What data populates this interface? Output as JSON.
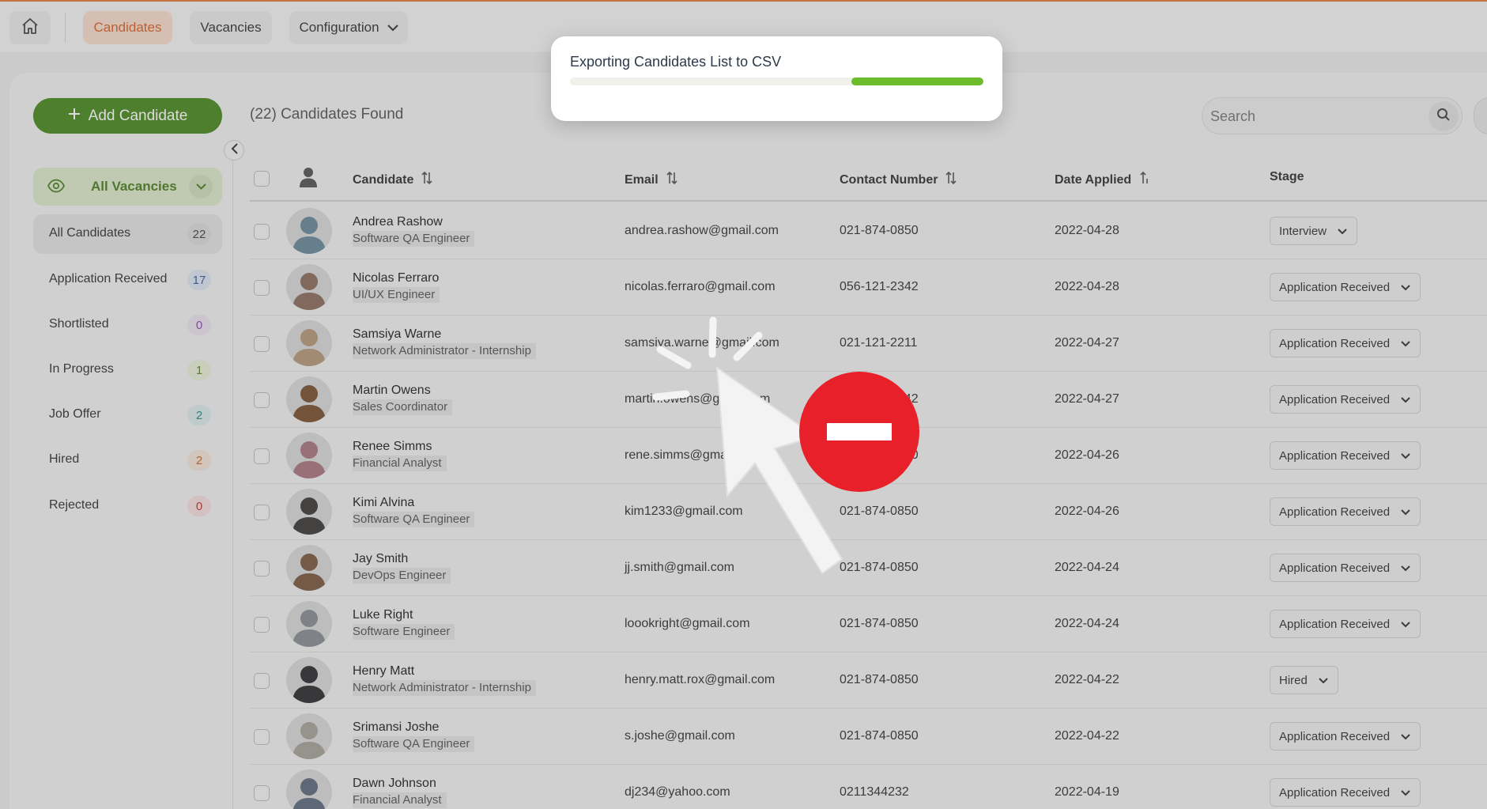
{
  "nav": {
    "home_icon": "home-icon",
    "tabs": [
      {
        "label": "Candidates",
        "active": true
      },
      {
        "label": "Vacancies",
        "active": false
      },
      {
        "label": "Configuration",
        "active": false,
        "has_dropdown": true
      }
    ]
  },
  "toolbar": {
    "add_label": "Add Candidate",
    "found_text": "(22) Candidates Found",
    "search_placeholder": "Search"
  },
  "vacancy_filter": {
    "label": "All Vacancies"
  },
  "stages": [
    {
      "label": "All Candidates",
      "count": "22",
      "active": true,
      "count_bg": "#dcdcdc",
      "count_color": "#444444"
    },
    {
      "label": "Application Received",
      "count": "17",
      "active": false,
      "count_bg": "#dde6f3",
      "count_color": "#3a5d9a"
    },
    {
      "label": "Shortlisted",
      "count": "0",
      "active": false,
      "count_bg": "#ece3f1",
      "count_color": "#8a4ca8"
    },
    {
      "label": "In Progress",
      "count": "1",
      "active": false,
      "count_bg": "#e8efd9",
      "count_color": "#5f8a25"
    },
    {
      "label": "Job Offer",
      "count": "2",
      "active": false,
      "count_bg": "#dcebe9",
      "count_color": "#2f8a80"
    },
    {
      "label": "Hired",
      "count": "2",
      "active": false,
      "count_bg": "#f3e3d8",
      "count_color": "#c86a2c"
    },
    {
      "label": "Rejected",
      "count": "0",
      "active": false,
      "count_bg": "#f5dede",
      "count_color": "#c63333"
    }
  ],
  "table": {
    "headers": {
      "candidate": "Candidate",
      "email": "Email",
      "contact": "Contact Number",
      "date": "Date Applied",
      "stage": "Stage"
    },
    "rows": [
      {
        "name": "Andrea Rashow",
        "role": "Software QA Engineer",
        "email": "andrea.rashow@gmail.com",
        "phone": "021-874-0850",
        "date": "2022-04-28",
        "stage": "Interview",
        "avatar_color": "#6b8a9c"
      },
      {
        "name": "Nicolas Ferraro",
        "role": "UI/UX Engineer",
        "email": "nicolas.ferraro@gmail.com",
        "phone": "056-121-2342",
        "date": "2022-04-28",
        "stage": "Application Received",
        "avatar_color": "#8c6e5e"
      },
      {
        "name": "Samsiya Warne",
        "role": "Network Administrator - Internship",
        "email": "samsiya.warne@gmail.com",
        "phone": "021-121-2211",
        "date": "2022-04-27",
        "stage": "Application Received",
        "avatar_color": "#b59a7a"
      },
      {
        "name": "Martin Owens",
        "role": "Sales Coordinator",
        "email": "martin.owens@gmail.com",
        "phone": "021-874-0842",
        "date": "2022-04-27",
        "stage": "Application Received",
        "avatar_color": "#7a5233"
      },
      {
        "name": "Renee Simms",
        "role": "Financial Analyst",
        "email": "rene.simms@gmail.com",
        "phone": "021-874-0850",
        "date": "2022-04-26",
        "stage": "Application Received",
        "avatar_color": "#a8787f"
      },
      {
        "name": "Kimi Alvina",
        "role": "Software QA Engineer",
        "email": "kim1233@gmail.com",
        "phone": "021-874-0850",
        "date": "2022-04-26",
        "stage": "Application Received",
        "avatar_color": "#3e3a3a"
      },
      {
        "name": "Jay Smith",
        "role": "DevOps Engineer",
        "email": "jj.smith@gmail.com",
        "phone": "021-874-0850",
        "date": "2022-04-24",
        "stage": "Application Received",
        "avatar_color": "#7d5a42"
      },
      {
        "name": "Luke Right",
        "role": "Software Engineer",
        "email": "loookright@gmail.com",
        "phone": "021-874-0850",
        "date": "2022-04-24",
        "stage": "Application Received",
        "avatar_color": "#8a8f96"
      },
      {
        "name": "Henry Matt",
        "role": "Network Administrator - Internship",
        "email": "henry.matt.rox@gmail.com",
        "phone": "021-874-0850",
        "date": "2022-04-22",
        "stage": "Hired",
        "avatar_color": "#2f2f33"
      },
      {
        "name": "Srimansi Joshe",
        "role": "Software QA Engineer",
        "email": "s.joshe@gmail.com",
        "phone": "021-874-0850",
        "date": "2022-04-22",
        "stage": "Application Received",
        "avatar_color": "#a6a39a"
      },
      {
        "name": "Dawn Johnson",
        "role": "Financial Analyst",
        "email": "dj234@yahoo.com",
        "phone": "0211344232",
        "date": "2022-04-19",
        "stage": "Application Received",
        "avatar_color": "#5f6b7d"
      }
    ]
  },
  "export_dialog": {
    "title": "Exporting Candidates List to CSV",
    "progress": 0.32
  },
  "colors": {
    "accent_orange": "#e07a3c",
    "primary_green": "#4a8a1f",
    "progress_green": "#6cbc2b",
    "blocked_red": "#e8202a"
  }
}
